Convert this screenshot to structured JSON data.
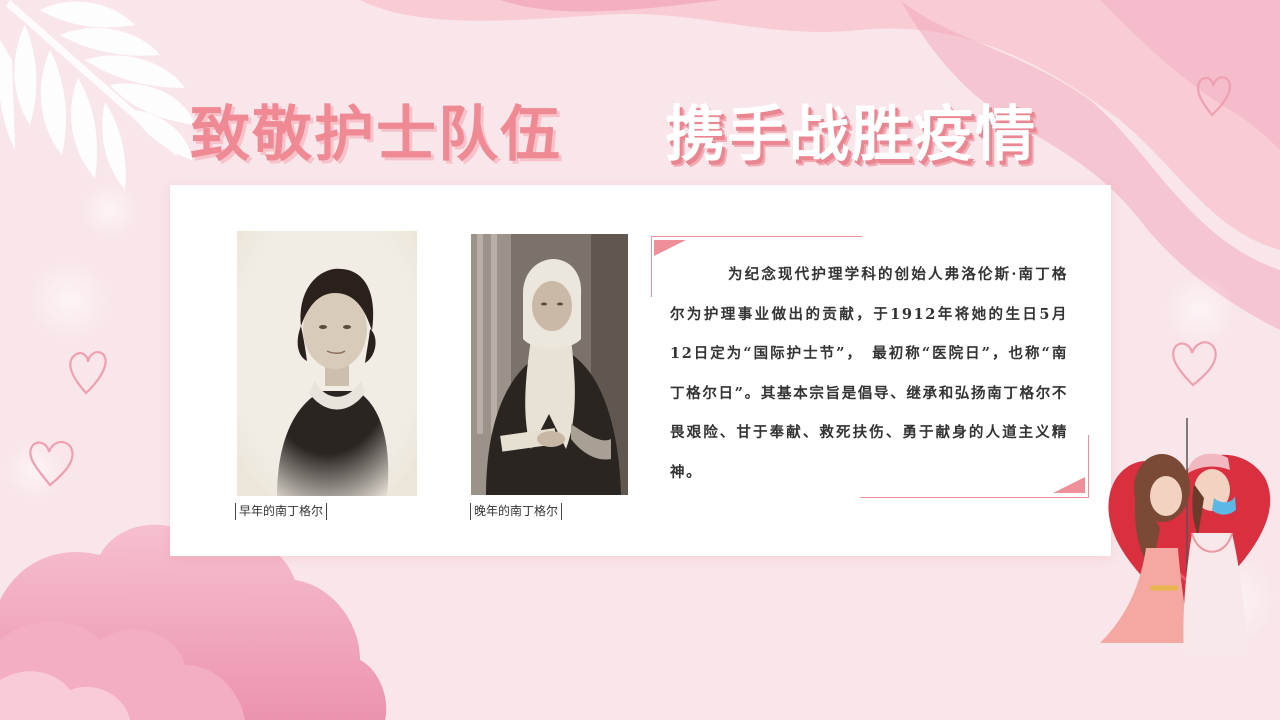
{
  "title": {
    "left": "致敬护士队伍",
    "right": "携手战胜疫情"
  },
  "photos": [
    {
      "caption": "早年的南丁格尔"
    },
    {
      "caption": "晚年的南丁格尔"
    }
  ],
  "body_text": "为纪念现代护理学科的创始人弗洛伦斯·南丁格尔为护理事业做出的贡献，于1912年将她的生日5月12日定为“国际护士节”，　最初称“医院日”，也称“南丁格尔日”。其基本宗旨是倡导、继承和弘扬南丁格尔不畏艰险、甘于奉献、救死扶伤、勇于献身的人道主义精神。",
  "colors": {
    "accent": "#ef8f9a",
    "background": "#f9e6ea",
    "title_pink": "#ef8a95",
    "card": "#ffffff"
  }
}
